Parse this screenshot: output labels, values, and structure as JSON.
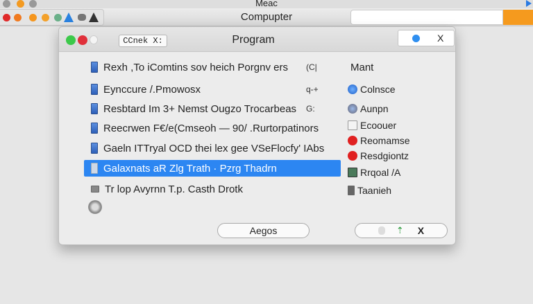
{
  "app": {
    "title": "Meac",
    "toolbar_title": "Compupter"
  },
  "dialog": {
    "title": "Program",
    "title_field": "CCnek X:",
    "close_label": "X",
    "list": [
      {
        "label": "Rexh ,To iComtins sov heich Porgnv ers",
        "shortcut": "(C|"
      },
      {
        "label": "Eynccure /.Pmowosx",
        "shortcut": "q-+"
      },
      {
        "label": "Resbtard Im 3+ Nemst Ougzo Trocarbeas",
        "shortcut": "G:"
      },
      {
        "label": "Reecrwen F€/e(Cmseoh — 90/ .Rurtorpatinors",
        "shortcut": ""
      },
      {
        "label": "Gaeln ITTryal OCD thei lex gee VSeFlocfy' IAbs",
        "shortcut": ""
      },
      {
        "label": "Galaxnats aR Zlg Trath · Pzrg Thadrn",
        "shortcut": "",
        "selected": true
      },
      {
        "label": "Tr lop Avyrnn T.p. Casth Drotk",
        "shortcut": ""
      }
    ],
    "side": {
      "heading": "Mant",
      "items": [
        "Colnsce",
        "Aunpn",
        "Ecoouer",
        "Reomamse",
        "Resdgiontz",
        "Rrqoal /A",
        "Taanieh"
      ]
    },
    "buttons": {
      "primary": "Aegos",
      "secondary_x": "X"
    }
  },
  "colors": {
    "accent": "#2c86f2",
    "orange": "#f59a1e"
  }
}
